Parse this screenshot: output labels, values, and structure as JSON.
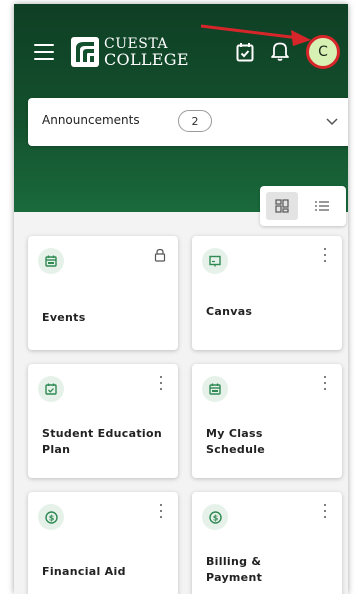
{
  "header": {
    "logo_line1": "CUESTA",
    "logo_line2": "COLLEGE",
    "avatar_initial": "C"
  },
  "announcements": {
    "label": "Announcements",
    "count": "2"
  },
  "cards": [
    {
      "title": "Events",
      "icon": "calendar-icon",
      "action": "lock-icon"
    },
    {
      "title": "Canvas",
      "icon": "presentation-icon",
      "action": "more-vert-icon"
    },
    {
      "title": "Student Education Plan",
      "icon": "calendar-check-icon",
      "action": "more-vert-icon"
    },
    {
      "title": "My Class Schedule",
      "icon": "calendar-icon",
      "action": "more-vert-icon"
    },
    {
      "title": "Financial Aid",
      "icon": "dollar-icon",
      "action": "more-vert-icon"
    },
    {
      "title": "Billing & Payment",
      "icon": "dollar-icon",
      "action": "more-vert-icon"
    }
  ],
  "colors": {
    "brand_green_dark": "#0f3f25",
    "brand_green": "#1a6a3c",
    "icon_green": "#2f8a54",
    "icon_bg": "#e6f1e9",
    "avatar_bg": "#d7f1b5",
    "annotation_red": "#d7262a"
  }
}
